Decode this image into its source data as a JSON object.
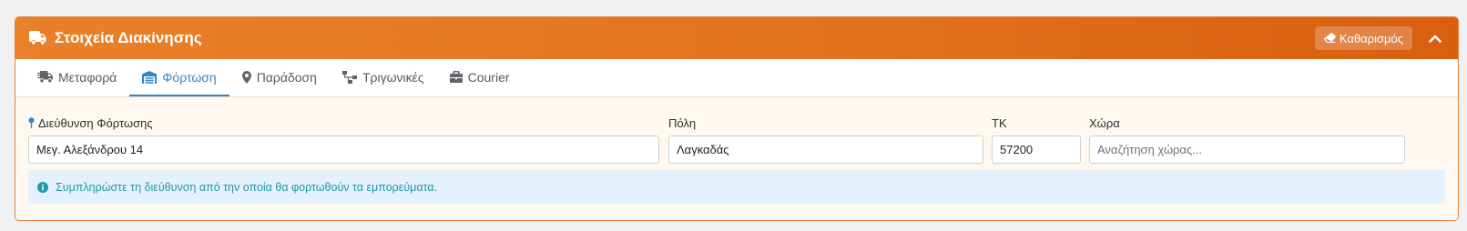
{
  "header": {
    "title": "Στοιχεία Διακίνησης",
    "clear_label": "Καθαρισμός"
  },
  "tabs": [
    {
      "label": "Μεταφορά",
      "icon": "shipping-fast-icon"
    },
    {
      "label": "Φόρτωση",
      "icon": "warehouse-icon"
    },
    {
      "label": "Παράδοση",
      "icon": "map-marker-icon"
    },
    {
      "label": "Τριγωνικές",
      "icon": "sitemap-icon"
    },
    {
      "label": "Courier",
      "icon": "briefcase-icon"
    }
  ],
  "active_tab": "Φόρτωση",
  "form": {
    "address": {
      "label": "Διεύθυνση Φόρτωσης",
      "value": "Μεγ. Αλεξάνδρου 14"
    },
    "city": {
      "label": "Πόλη",
      "value": "Λαγκαδάς"
    },
    "zip": {
      "label": "ΤΚ",
      "value": "57200"
    },
    "country": {
      "label": "Χώρα",
      "value": "",
      "placeholder": "Αναζήτηση χώρας..."
    }
  },
  "info": {
    "text": "Συμπληρώστε τη διεύθυνση από την οποία θα φορτωθούν τα εμπορεύματα."
  },
  "colors": {
    "accent": "#e3731f",
    "tab_active": "#2f86c8",
    "info_text": "#1f9aa8"
  }
}
